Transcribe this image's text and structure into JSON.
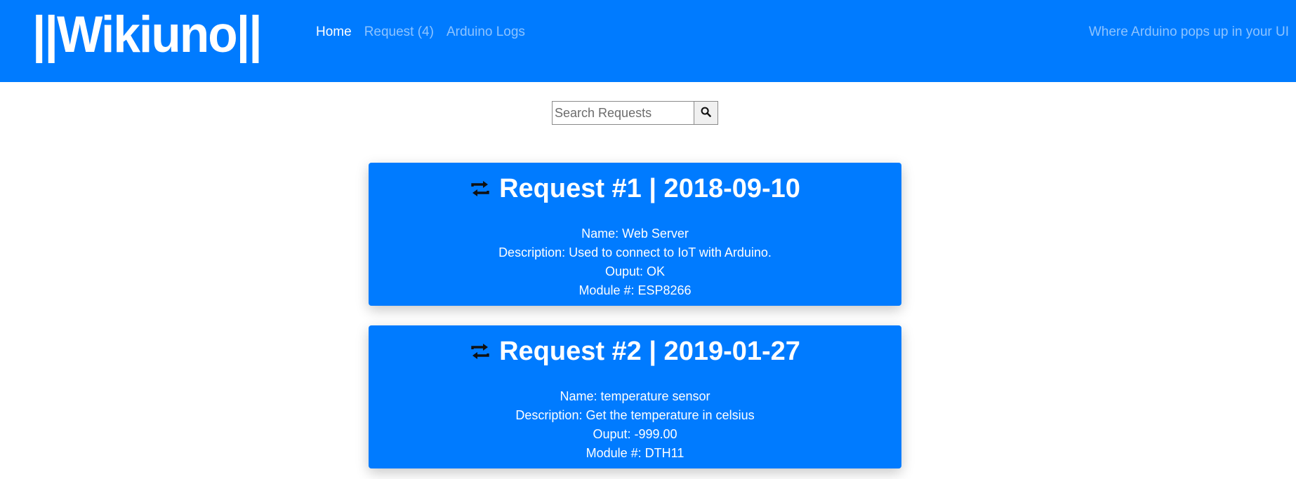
{
  "header": {
    "brand": "||Wikiuno||",
    "nav": [
      {
        "label": "Home",
        "active": true
      },
      {
        "label": "Request (4)",
        "active": false
      },
      {
        "label": "Arduino Logs",
        "active": false
      }
    ],
    "tagline": "Where Arduino pops up in your UI"
  },
  "search": {
    "placeholder": "Search Requests",
    "value": "",
    "button_icon": "search-icon"
  },
  "requests": [
    {
      "title": "Request #1 | 2018-09-10",
      "icon": "exchange-icon",
      "name": "Name: Web Server",
      "description": "Description: Used to connect to IoT with Arduino.",
      "output": "Ouput: OK",
      "module": "Module #: ESP8266"
    },
    {
      "title": "Request #2 | 2019-01-27",
      "icon": "exchange-icon",
      "name": "Name: temperature sensor",
      "description": "Description: Get the temperature in celsius",
      "output": "Ouput: -999.00",
      "module": "Module #: DTH11"
    }
  ],
  "colors": {
    "primary": "#007bff",
    "text_light": "#ffffff",
    "nav_muted": "rgba(255,255,255,0.55)"
  }
}
